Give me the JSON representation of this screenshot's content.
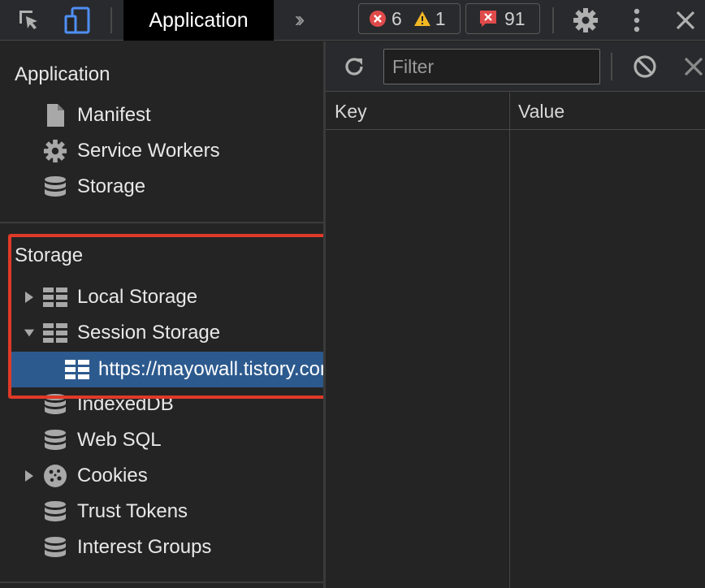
{
  "toolbar": {
    "active_tab": "Application",
    "errors_count": "6",
    "warnings_count": "1",
    "issues_count": "91",
    "icons": [
      "inspect-element-icon",
      "device-toolbar-icon",
      "more-tabs-icon",
      "gear-icon",
      "kebab-menu-icon",
      "close-icon"
    ]
  },
  "sidebar": {
    "application_section": {
      "title": "Application",
      "items": [
        {
          "label": "Manifest",
          "icon": "file-icon"
        },
        {
          "label": "Service Workers",
          "icon": "gear-icon"
        },
        {
          "label": "Storage",
          "icon": "database-icon"
        }
      ]
    },
    "storage_section": {
      "title": "Storage",
      "items": [
        {
          "label": "Local Storage",
          "icon": "table-icon",
          "expanded": false
        },
        {
          "label": "Session Storage",
          "icon": "table-icon",
          "expanded": true
        },
        {
          "label": "https://mayowall.tistory.com",
          "icon": "table-icon",
          "selected": true
        },
        {
          "label": "IndexedDB",
          "icon": "database-icon"
        },
        {
          "label": "Web SQL",
          "icon": "database-icon"
        },
        {
          "label": "Cookies",
          "icon": "cookie-icon",
          "expanded": false
        },
        {
          "label": "Trust Tokens",
          "icon": "database-icon"
        },
        {
          "label": "Interest Groups",
          "icon": "database-icon"
        }
      ]
    }
  },
  "main": {
    "filter_placeholder": "Filter",
    "columns": [
      "Key",
      "Value"
    ],
    "rows": []
  },
  "colors": {
    "selection": "#2d5a8e",
    "highlight_annotation": "#e03a28",
    "error_badge": "#e04a4a",
    "warning_badge": "#f2b824"
  }
}
